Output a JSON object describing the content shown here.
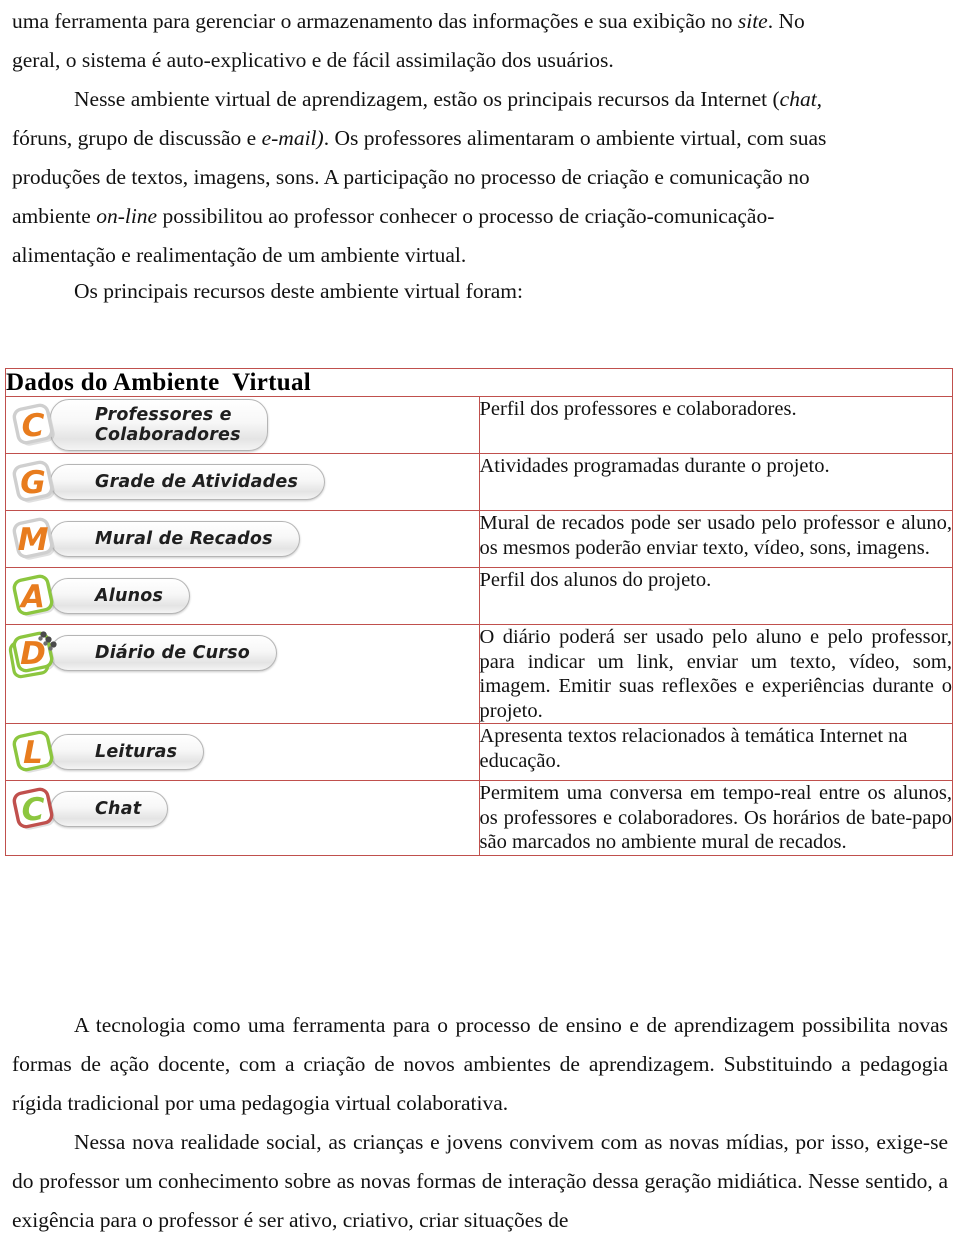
{
  "document": {
    "paragraphs_top": [
      "uma ferramenta para gerenciar o armazenamento das informações e sua exibição no ",
      "geral, o sistema é auto-explicativo e de fácil assimilação dos usuários."
    ],
    "p1_italic": "site",
    "p1_tail": ". No",
    "p2": "Nesse ambiente virtual de aprendizagem, estão os principais recursos da Internet (",
    "p2_italic_1": "chat,",
    "p2_line2_a": "fóruns, grupo de discussão e ",
    "p2_italic_2": "e-mail)",
    "p2_line2_b": ". Os professores alimentaram o ambiente virtual, com suas",
    "p2_line3": "produções de textos, imagens, sons. A participação no processo de criação e comunicação no",
    "p2_line4_a": "ambiente ",
    "p2_italic_3": "on-line",
    "p2_line4_b": " possibilitou ao professor conhecer o processo de criação-comunicação-",
    "p2_line5": "alimentação e realimentação de um ambiente virtual.",
    "p3": "Os principais recursos  deste ambiente virtual  foram:",
    "paragraphs_bottom": [
      "A tecnologia como uma ferramenta para o processo de ensino e de aprendizagem possibilita novas formas de ação docente, com a criação de novos ambientes de aprendizagem. Substituindo a pedagogia rígida tradicional por uma pedagogia  virtual colaborativa.",
      "Nessa nova realidade social, as crianças e jovens convivem com as novas mídias, por isso, exige-se do professor um conhecimento sobre as novas formas de interação dessa geração midiática. Nesse sentido, a exigência para o professor é ser ativo, criativo, criar situações de"
    ]
  },
  "table": {
    "heading": "Dados do Ambiente  Virtual",
    "border_color": "#c0504d",
    "rows": [
      {
        "icon_letter": "C",
        "icon_name": "professores-colaboradores-icon",
        "letter_color": "#e87c1e",
        "frame_color": "#cfcfcf",
        "label": "Professores e\nColaboradores",
        "two_line": true,
        "description": "Perfil  dos  professores e colaboradores.",
        "justify": false
      },
      {
        "icon_letter": "G",
        "icon_name": "grade-atividades-icon",
        "letter_color": "#e87c1e",
        "frame_color": "#cfcfcf",
        "label": "Grade de Atividades",
        "two_line": false,
        "description": "Atividades  programadas  durante o  projeto.",
        "justify": false
      },
      {
        "icon_letter": "M",
        "icon_name": "mural-recados-icon",
        "letter_color": "#e87c1e",
        "frame_color": "#cfcfcf",
        "label": "Mural de Recados",
        "two_line": false,
        "description": "Mural de recados pode ser usado pelo professor e aluno, os mesmos poderão enviar texto, vídeo, sons, imagens.",
        "justify": true
      },
      {
        "icon_letter": "A",
        "icon_name": "alunos-icon",
        "letter_color": "#e87c1e",
        "frame_color": "#8cc63f",
        "label": "Alunos",
        "two_line": false,
        "description": "Perfil  dos  alunos do  projeto.",
        "justify": false
      },
      {
        "icon_letter": "D",
        "icon_name": "diario-curso-icon",
        "letter_color": "#e87c1e",
        "frame_color": "#8cc63f",
        "label": "Diário de Curso",
        "two_line": false,
        "notebook": true,
        "description": "O diário poderá ser usado   pelo aluno e pelo professor, para indicar um   link, enviar um texto,  vídeo, som, imagem. Emitir suas reflexões e experiências durante  o projeto.",
        "justify": true
      },
      {
        "icon_letter": "L",
        "icon_name": "leituras-icon",
        "letter_color": "#e87c1e",
        "frame_color": "#8cc63f",
        "label": "Leituras",
        "two_line": false,
        "description": "Apresenta textos  relacionados à temática Internet na  educação.",
        "justify": false
      },
      {
        "icon_letter": "C",
        "icon_name": "chat-icon",
        "letter_color": "#8cc63f",
        "frame_color": "#c0504d",
        "label": "Chat",
        "two_line": false,
        "description": "Permitem uma conversa em tempo-real entre os alunos,   os professores e colaboradores. Os horários de bate-papo são marcados no  ambiente mural de  recados.",
        "justify": true
      }
    ]
  }
}
